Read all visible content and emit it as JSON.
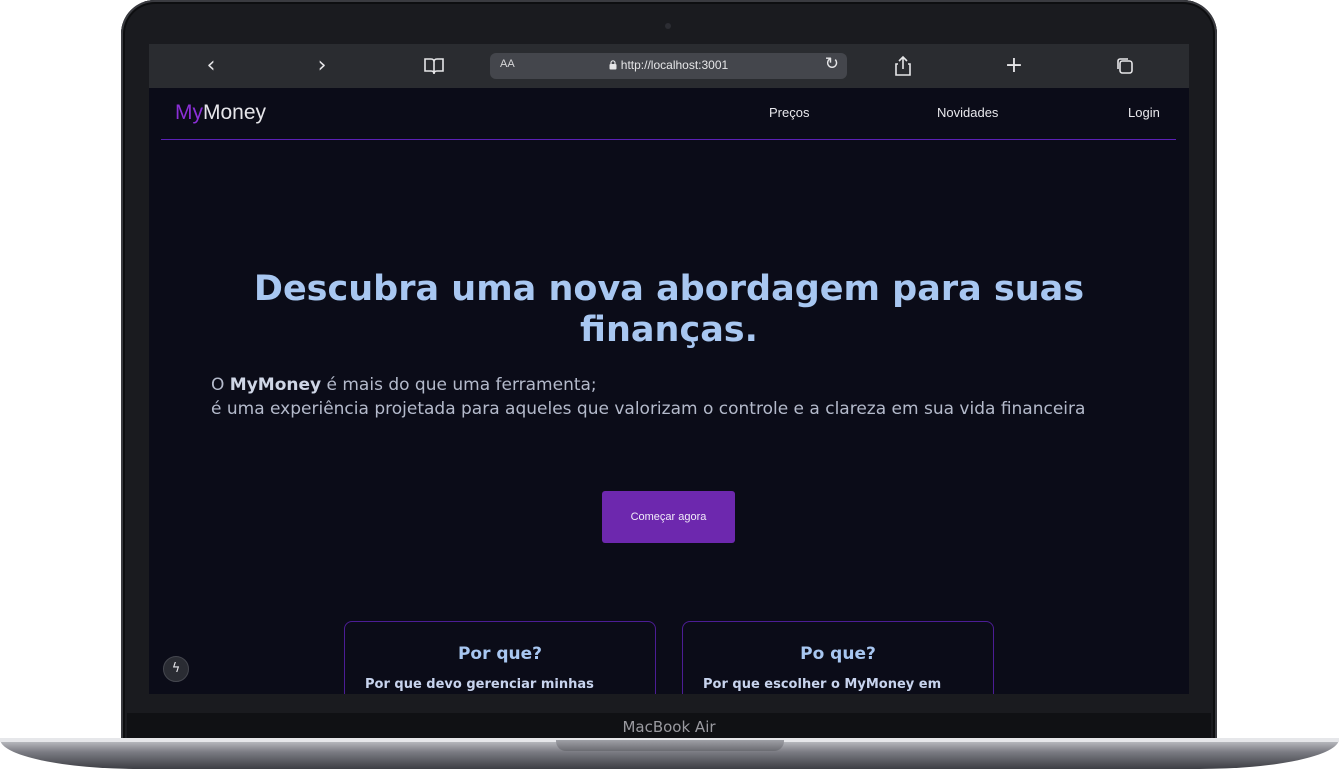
{
  "device": {
    "label": "MacBook Air"
  },
  "browser": {
    "back_icon": "‹",
    "forward_icon": "›",
    "bookmarks_icon": "book-icon",
    "text_size_label": "AA",
    "url": "http://localhost:3001",
    "reload_icon": "reload-icon",
    "share_icon": "share-icon",
    "new_tab_icon": "+",
    "tabs_icon": "tabs-icon"
  },
  "nav": {
    "logo_prefix": "My",
    "logo_suffix": "Money",
    "links": [
      "Preços",
      "Novidades",
      "Login"
    ]
  },
  "hero": {
    "title": "Descubra uma nova abordagem para suas finanças.",
    "desc_prefix": "O ",
    "desc_brand": "MyMoney",
    "desc_line1_rest": " é mais do que uma ferramenta;",
    "desc_line2": "é uma experiência projetada para aqueles que valorizam o controle e a clareza em sua vida financeira",
    "cta_label": "Começar agora"
  },
  "cards": [
    {
      "title": "Por que?",
      "text": "Por que devo gerenciar minhas"
    },
    {
      "title": "Po que?",
      "text": "Por que escolher o MyMoney em"
    }
  ],
  "colors": {
    "background": "#0b0c18",
    "accent": "#6d28ae",
    "title": "#a8c7f1",
    "border": "#5b21b6"
  }
}
